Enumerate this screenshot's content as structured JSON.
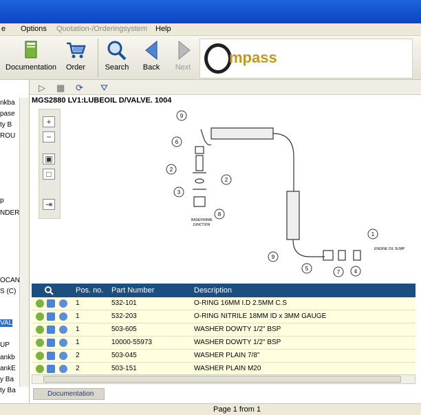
{
  "menu": {
    "items": [
      {
        "label": "e",
        "disabled": false
      },
      {
        "label": "Options",
        "disabled": false
      },
      {
        "label": "Quotation-/Orderingsystem",
        "disabled": true
      },
      {
        "label": "Help",
        "disabled": false
      }
    ]
  },
  "toolbar": {
    "documentation": "Documentation",
    "order": "Order",
    "search": "Search",
    "back": "Back",
    "next": "Next"
  },
  "logo": {
    "text": "mpass"
  },
  "tree": {
    "items": [
      "nkba",
      "pase",
      "ty B",
      "ROU",
      "p",
      "NDER",
      "OCAN",
      "S (C)",
      "VAL",
      "UP",
      "ankb",
      "ankE",
      "y Ba",
      "ty Ba"
    ]
  },
  "breadcrumb": "MGS2880 LV1:LUBEOIL D/VALVE. 1004",
  "drawing": {
    "labels": {
      "baseframe": "BASEFRAME",
      "junction": "JUNCTION",
      "engine": "ENGINE OIL SUMP"
    },
    "callouts": [
      "9",
      "6",
      "2",
      "2",
      "3",
      "8",
      "1",
      "9",
      "5",
      "7",
      "4"
    ]
  },
  "table": {
    "headers": {
      "pos": "Pos. no.",
      "part": "Part Number",
      "desc": "Description"
    },
    "rows": [
      {
        "pos": "1",
        "part": "532-101",
        "desc": "O-RING 16MM I.D 2.5MM C.S"
      },
      {
        "pos": "1",
        "part": "532-203",
        "desc": "O-RING NITRILE 18MM ID x 3MM GAUGE"
      },
      {
        "pos": "1",
        "part": "503-605",
        "desc": "WASHER DOWTY 1/2\" BSP"
      },
      {
        "pos": "1",
        "part": "10000-55973",
        "desc": "WASHER DOWTY 1/2\" BSP"
      },
      {
        "pos": "2",
        "part": "503-045",
        "desc": "WASHER PLAIN 7/8\""
      },
      {
        "pos": "2",
        "part": "503-151",
        "desc": "WASHER PLAIN M20"
      }
    ]
  },
  "tabs": {
    "documentation": "Documentation"
  },
  "status": {
    "page": "Page 1 from 1"
  },
  "colors": {
    "title": "#0a45c4",
    "header": "#1c4f80",
    "row": "#ffffe0",
    "logo": "#c09a20"
  }
}
